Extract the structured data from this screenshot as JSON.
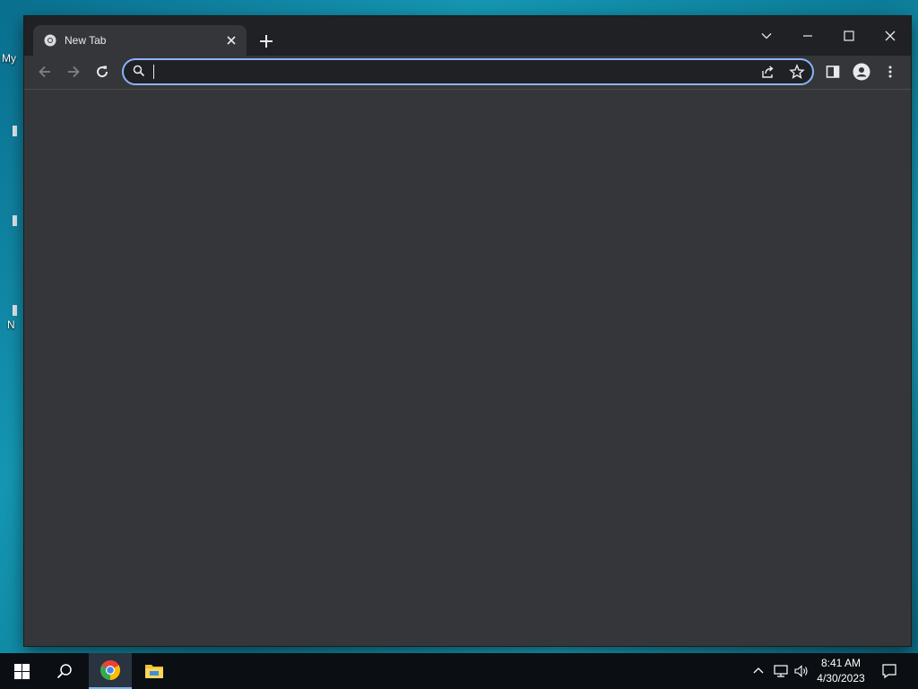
{
  "desktop": {
    "labels": [
      "My",
      "N"
    ]
  },
  "browser": {
    "tab": {
      "title": "New Tab",
      "favicon": "chrome-icon"
    },
    "toolbar": {
      "back": "arrow-left-icon",
      "forward": "arrow-right-icon",
      "reload": "reload-icon",
      "side_panel": "side-panel-icon",
      "profile": "profile-icon",
      "menu": "kebab-menu-icon"
    },
    "omnibox": {
      "value": "",
      "placeholder": ""
    },
    "window_controls": [
      "chevron-down-icon",
      "minimize-icon",
      "maximize-icon",
      "close-icon"
    ]
  },
  "taskbar": {
    "time": "8:41 AM",
    "date": "4/30/2023",
    "pinned": [
      "windows-start-icon",
      "search-icon",
      "chrome-icon",
      "file-explorer-icon"
    ],
    "tray": [
      "chevron-up-icon",
      "network-icon",
      "volume-icon",
      "notification-icon"
    ]
  },
  "colors": {
    "frame": "#202124",
    "toolbar": "#35363a",
    "omnibox_focus": "#8ab4f8",
    "taskbar": "#0b0f14"
  }
}
